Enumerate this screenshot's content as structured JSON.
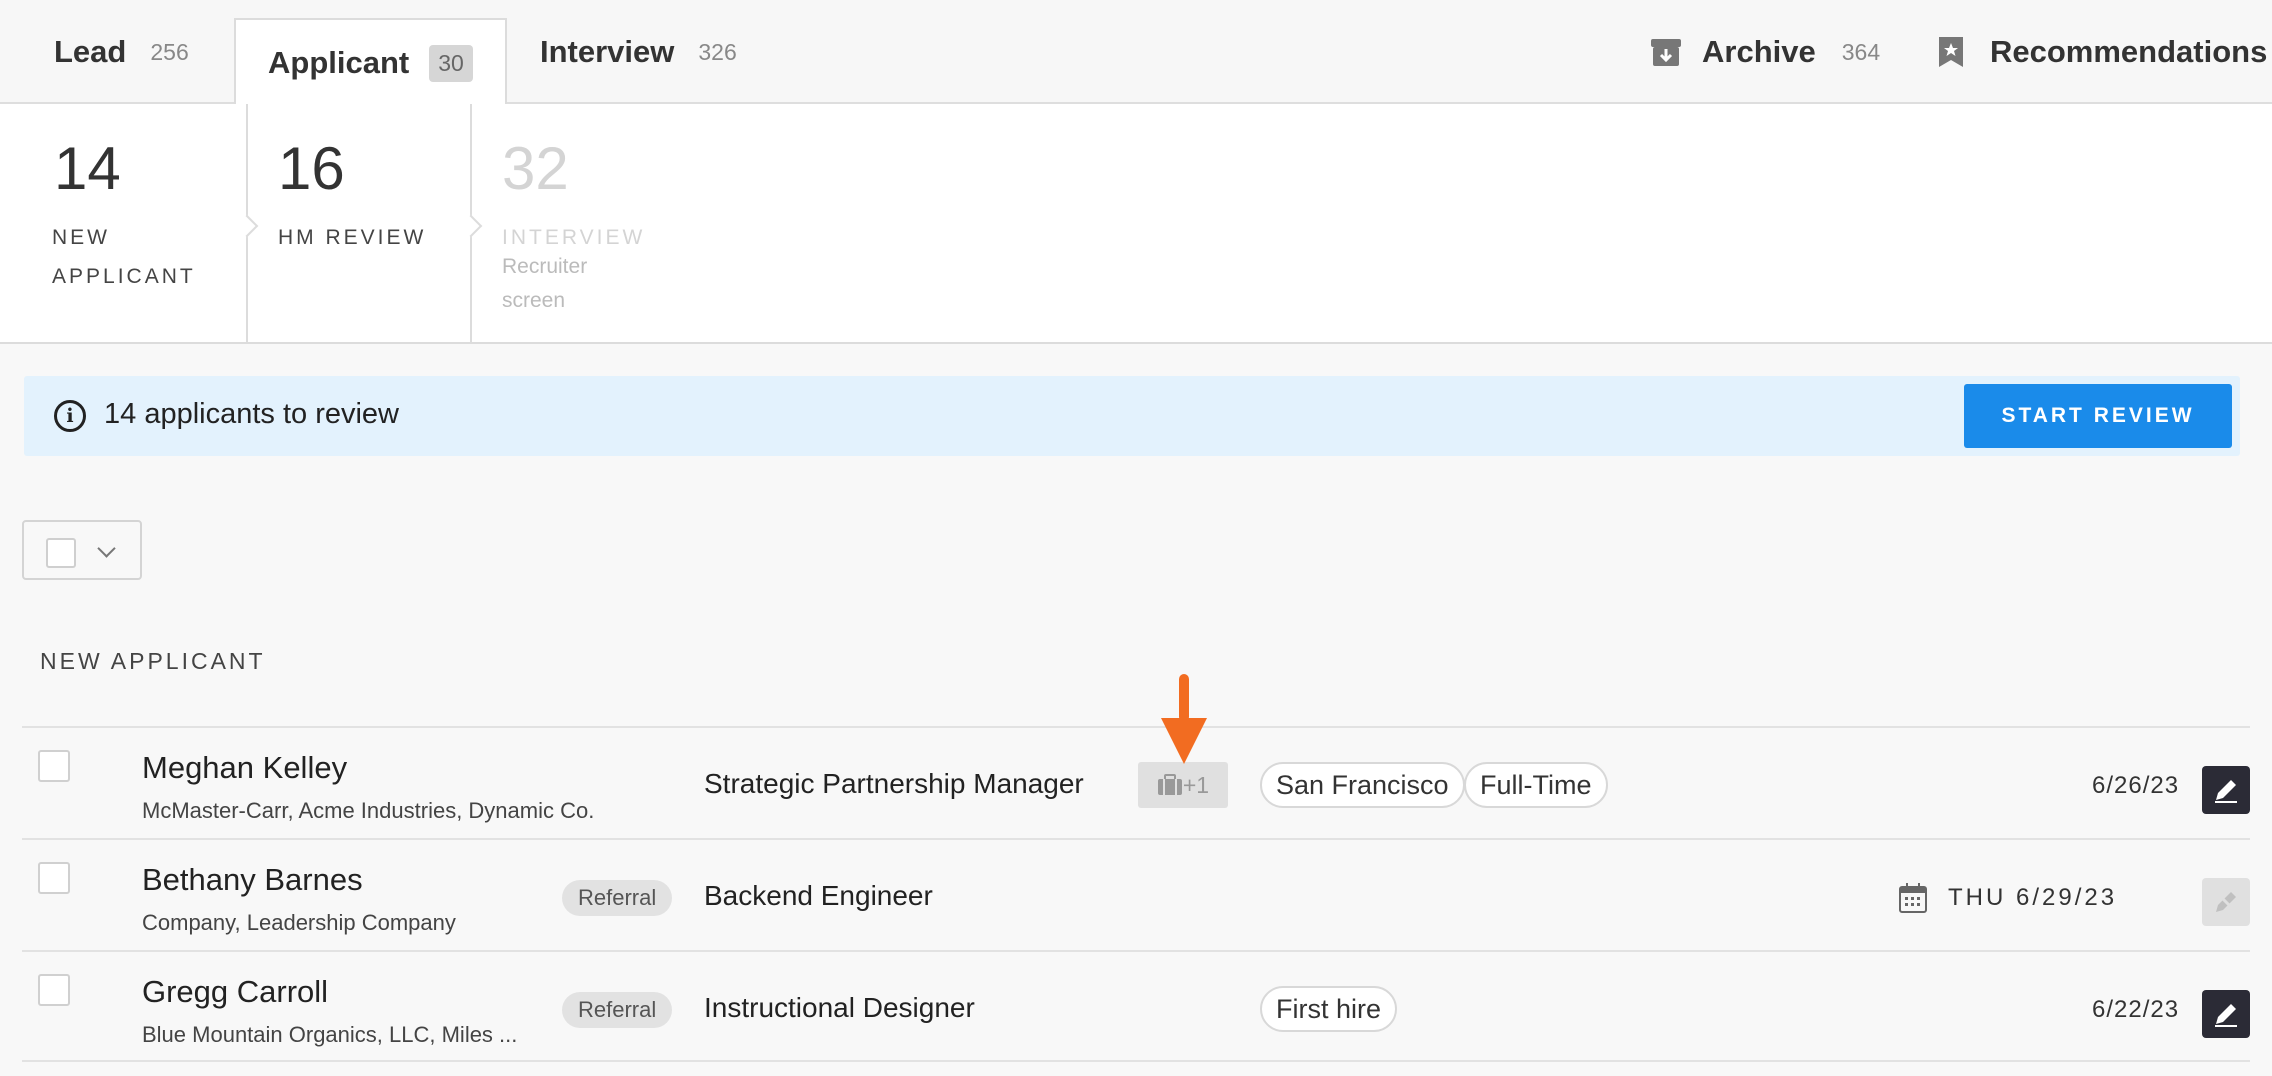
{
  "tabs": [
    {
      "label": "Lead",
      "count": "256"
    },
    {
      "label": "Applicant",
      "count": "30"
    },
    {
      "label": "Interview",
      "count": "326"
    }
  ],
  "nav_right": {
    "archive": {
      "label": "Archive",
      "count": "364",
      "icon": "archive-box-icon"
    },
    "recommendations": {
      "label": "Recommendations",
      "icon": "bookmark-star-icon"
    }
  },
  "stages": [
    {
      "count": "14",
      "name_line1": "NEW",
      "name_line2": "APPLICANT"
    },
    {
      "count": "16",
      "name_line1": "HM REVIEW"
    },
    {
      "count": "32",
      "name_line1": "INTERVIEW",
      "sub_line1": "Recruiter",
      "sub_line2": "screen"
    }
  ],
  "banner": {
    "text": "14 applicants to review",
    "button": "START REVIEW",
    "icon": "info-icon"
  },
  "section_title": "NEW APPLICANT",
  "rows": [
    {
      "name": "Meghan Kelley",
      "company": "McMaster-Carr, Acme Industries, Dynamic Co.",
      "job": "Strategic Partnership Manager",
      "jobs_extra": "+1",
      "tags": [
        "San Francisco",
        "Full-Time"
      ],
      "date": "6/26/23"
    },
    {
      "name": "Bethany Barnes",
      "company": "Company, Leadership Company",
      "badge": "Referral",
      "job": "Backend Engineer",
      "date": "THU 6/29/23"
    },
    {
      "name": "Gregg Carroll",
      "company": "Blue Mountain Organics, LLC, Miles ...",
      "badge": "Referral",
      "job": "Instructional Designer",
      "tags": [
        "First hire"
      ],
      "date": "6/22/23"
    }
  ],
  "colors": {
    "accent": "#1a8bea",
    "banner_bg": "#e3f2fd",
    "arrow": "#f26c21",
    "action_dark": "#2b2b36"
  }
}
